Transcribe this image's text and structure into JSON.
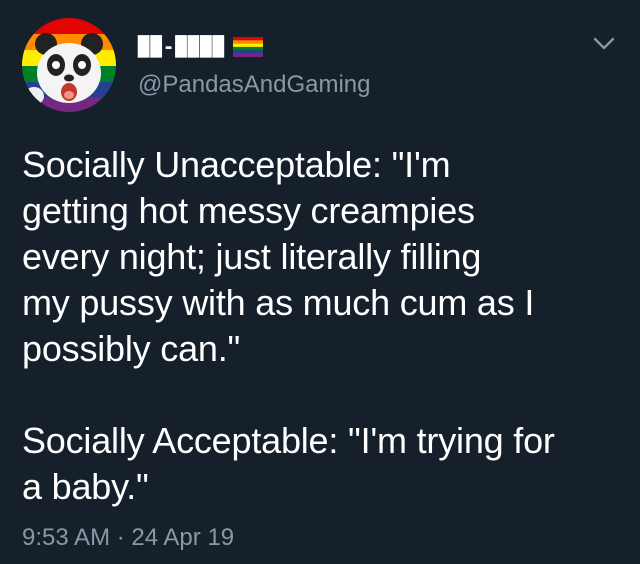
{
  "user": {
    "display_name": "██-████",
    "handle": "@PandasAndGaming",
    "avatar_icon": "panda-avatar-icon",
    "flag_icon": "rainbow-flag-icon"
  },
  "menu": {
    "chevron_icon": "chevron-down-icon"
  },
  "tweet": {
    "lines_para1": [
      "Socially Unacceptable: \"I'm",
      "getting hot messy creampies",
      "every night; just literally filling",
      "my pussy with as much cum as I",
      "possibly can.\""
    ],
    "lines_para2": [
      "Socially Acceptable: \"I'm trying for",
      "a baby.\""
    ],
    "timestamp": "9:53 AM · 24 Apr 19"
  },
  "colors": {
    "background": "#15202b",
    "primary_text": "#ffffff",
    "secondary_text": "#8899a6"
  }
}
